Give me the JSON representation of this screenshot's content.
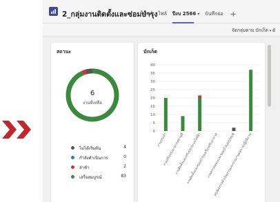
{
  "decoration": {
    "chevron_color": "#c4262e"
  },
  "header": {
    "title": "2_กลุ่มงานติดตั้งและซ่อมบำรุง",
    "tabs": [
      {
        "label": "โพสต์",
        "active": false
      },
      {
        "label": "ไฟล์",
        "active": false
      },
      {
        "label": "ปีงบ 2566",
        "active": true
      },
      {
        "label": "บันทึกย่อ",
        "active": false
      }
    ],
    "add_tab_symbol": "+"
  },
  "filterbar": {
    "group_by_label": "จัดกลุ่มตาม บักเก็ต",
    "cut_label": "ตั"
  },
  "status_card": {
    "title": "สถานะ",
    "center_value": "6",
    "center_label": "งานที่เหลือ",
    "items": [
      {
        "label": "ไม่ได้เริ่มต้น",
        "value": 4,
        "color": "#555555"
      },
      {
        "label": "กำลังดำเนินการ",
        "value": 0,
        "color": "#2f78c4"
      },
      {
        "label": "ล่าช้า",
        "value": 2,
        "color": "#d13438"
      },
      {
        "label": "เสร็จสมบูรณ์",
        "value": 83,
        "color": "#3a8a3e"
      }
    ]
  },
  "bucket_card": {
    "title": "บักเก็ต"
  },
  "chart_data": {
    "type": "bar",
    "stacked": true,
    "ylim": [
      0,
      40
    ],
    "yticks": [
      0,
      5,
      10,
      15,
      20,
      25,
      30,
      35,
      40
    ],
    "categories": [
      "งานประจำ",
      "งานปรับปรุงอาคารสถานที่",
      "งานติดตั้งและปรับปรุงระบบไฟฟ้า",
      "งานติดตั้งและซ่อมบำรุงเครื่องปรับอากาศ",
      "งานตรวจสอบและซ่อมบำรุงครุภัณฑ์",
      "สรุปผลการดำเนินงานและรายงานผลการปฏิบัติงาน"
    ],
    "series": [
      {
        "name": "เสร็จสมบูรณ์",
        "color": "#3a8a3e",
        "values": [
          20,
          9,
          20,
          0,
          0,
          37
        ]
      },
      {
        "name": "ล่าช้า",
        "color": "#d13438",
        "values": [
          0,
          0,
          1.5,
          0,
          0,
          0
        ]
      },
      {
        "name": "ไม่ได้เริ่มต้น",
        "color": "#555555",
        "values": [
          0,
          0,
          0,
          0,
          2,
          0
        ]
      }
    ]
  }
}
